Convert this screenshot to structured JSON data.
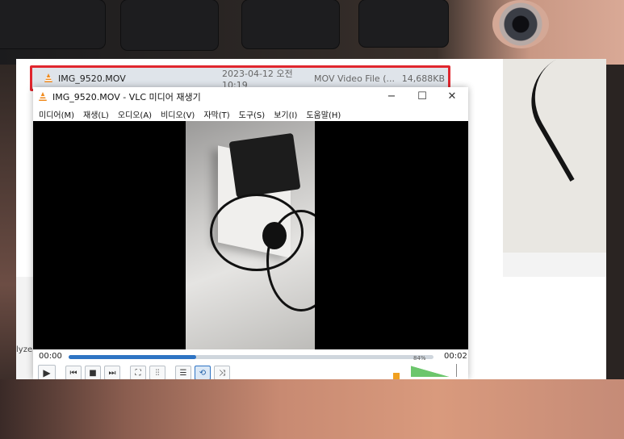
{
  "explorer": {
    "file": {
      "name": "IMG_9520.MOV",
      "date": "2023-04-12 오전 10:19",
      "type": "MOV Video File (...",
      "size": "14,688KB"
    }
  },
  "vlc": {
    "title": "IMG_9520.MOV - VLC 미디어 재생기",
    "window_buttons": {
      "minimize": "−",
      "maximize": "☐",
      "close": "✕"
    },
    "menu": [
      "미디어(M)",
      "재생(L)",
      "오디오(A)",
      "비디오(V)",
      "자막(T)",
      "도구(S)",
      "보기(I)",
      "도움말(H)"
    ],
    "time_elapsed": "00:00",
    "time_total": "00:02",
    "progress_fraction": 0.35,
    "volume_text": "84%",
    "volume_fraction": 0.84,
    "controls": {
      "play": "▶",
      "prev": "⏮",
      "stop": "■",
      "next": "⏭",
      "fullscreen": "⛶",
      "eq": "⫶⫶",
      "playlist": "☰",
      "loop": "⟲",
      "shuffle": "⤨"
    }
  },
  "desktop": {
    "side_label": "lyze"
  },
  "colors": {
    "highlight_border": "#e0262e",
    "vlc_accent": "#2e74c4",
    "vlc_cone": "#f08a1c"
  }
}
